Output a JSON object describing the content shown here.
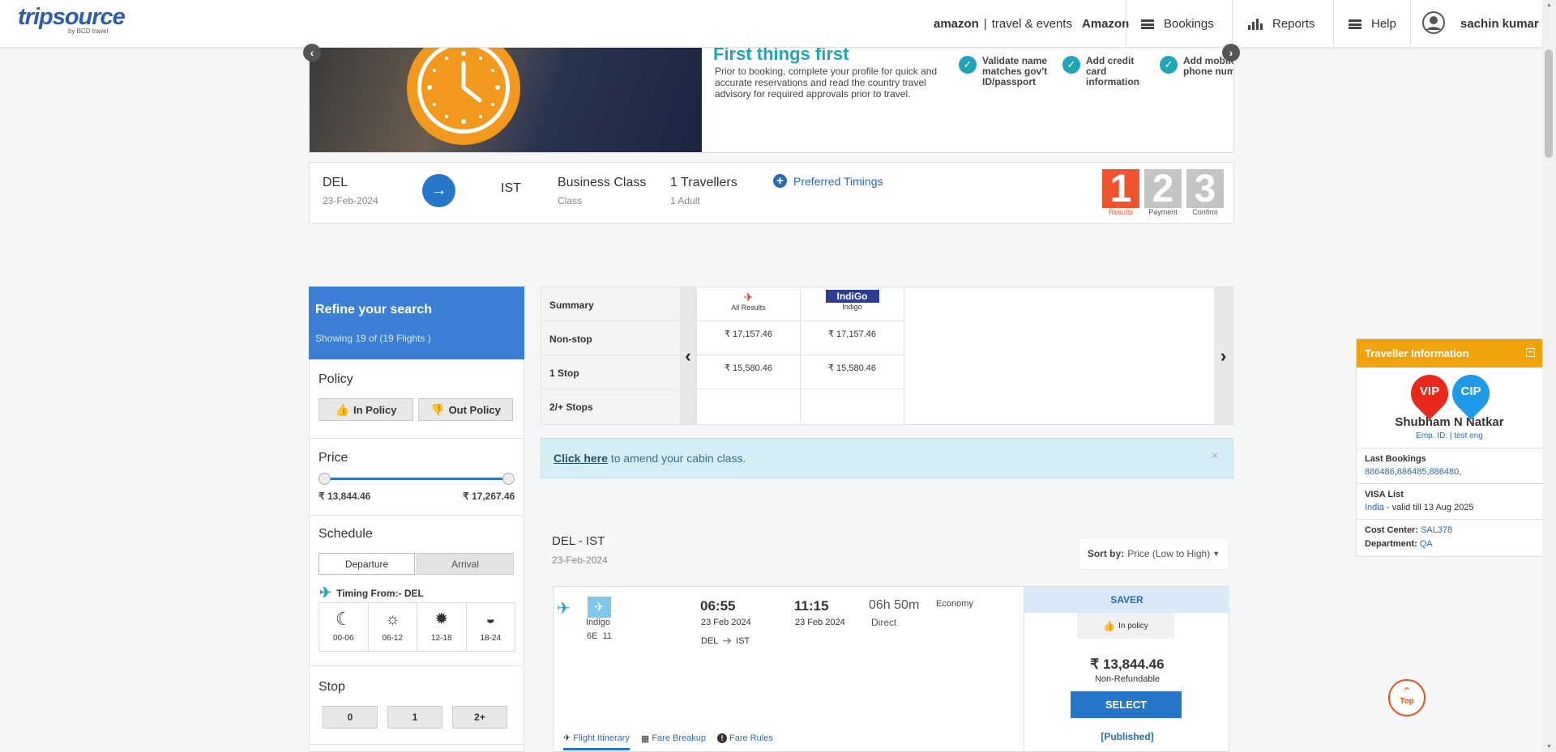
{
  "header": {
    "logo_main": "tripsource",
    "logo_sub": "by BCD travel",
    "amazon_brand": "amazon",
    "amazon_tagline": "travel & events",
    "amazon_label": "Amazon",
    "nav": [
      {
        "label": "Bookings",
        "icon": "menu-icon"
      },
      {
        "label": "Reports",
        "icon": "bar-chart-icon"
      },
      {
        "label": "Help",
        "icon": "menu-icon"
      }
    ],
    "user_name": "sachin kumar"
  },
  "banner": {
    "title": "First things first",
    "text": "Prior to booking, complete your profile for quick and accurate reservations and read the country travel advisory for required approvals prior to travel.",
    "checks": [
      "Validate name matches gov't ID/passport",
      "Add credit card information",
      "Add mobile phone number"
    ]
  },
  "search": {
    "origin": "DEL",
    "date": "23-Feb-2024",
    "destination": "IST",
    "cabin": "Business Class",
    "cabin_label": "Class",
    "travellers": "1 Travellers",
    "travellers_sub": "1 Adult",
    "preferred_timings": "Preferred Timings",
    "steps": [
      {
        "num": "1",
        "label": "Results",
        "color": "#f0532d",
        "active": true
      },
      {
        "num": "2",
        "label": "Payment",
        "color": "#c4c4c4",
        "active": false
      },
      {
        "num": "3",
        "label": "Confirm",
        "color": "#c4c4c4",
        "active": false
      }
    ]
  },
  "sidebar": {
    "title": "Refine your search",
    "showing": "Showing 19 of (19 Flights )",
    "policy_title": "Policy",
    "in_policy": "In Policy",
    "out_policy": "Out Policy",
    "price_title": "Price",
    "price_min": "₹ 13,844.46",
    "price_max": "₹ 17,267.46",
    "schedule_title": "Schedule",
    "departure": "Departure",
    "arrival": "Arrival",
    "timing_from": "Timing From:- DEL",
    "time_slots": [
      {
        "label": "00-06",
        "icon": "moon-icon"
      },
      {
        "label": "06-12",
        "icon": "sunrise-icon"
      },
      {
        "label": "12-18",
        "icon": "sun-icon"
      },
      {
        "label": "18-24",
        "icon": "sunset-icon"
      }
    ],
    "stop_title": "Stop",
    "stops": [
      "0",
      "1",
      "2+"
    ]
  },
  "matrix": {
    "row_labels": [
      "Summary",
      "Non-stop",
      "1 Stop",
      "2/+ Stops"
    ],
    "columns": [
      {
        "name": "All Results",
        "nonstop": "₹ 17,157.46",
        "one_stop": "₹ 15,580.46",
        "two_stop": ""
      },
      {
        "name": "Indigo",
        "logo": "IndiGo",
        "nonstop": "₹ 17,157.46",
        "one_stop": "₹ 15,580.46",
        "two_stop": ""
      }
    ]
  },
  "alert": {
    "link": "Click here",
    "text": " to amend your cabin class."
  },
  "results": {
    "route": "DEL - IST",
    "date": "23-Feb-2024",
    "sort_label": "Sort by:",
    "sort_value": "Price (Low to High)"
  },
  "flight": {
    "airline": "Indigo",
    "flight_no": "6E  11",
    "dep_time": "06:55",
    "dep_date": "23 Feb 2024",
    "arr_time": "11:15",
    "arr_date": "23 Feb 2024",
    "duration": "06h 50m",
    "stops": "Direct",
    "cabin": "Economy",
    "from": "DEL",
    "to": "IST",
    "fare_type": "SAVER",
    "policy": "In policy",
    "price": "₹ 13,844.46",
    "refund": "Non-Refundable",
    "select": "SELECT",
    "published": "[Published]",
    "tabs": [
      "Flight Itinerary",
      "Fare Breakup",
      "Fare Rules"
    ]
  },
  "traveller": {
    "title": "Traveller Information",
    "badges": [
      "VIP",
      "CIP"
    ],
    "name": "Shubham N Natkar",
    "emp": "Emp. ID: | test eng",
    "last_bookings_label": "Last Bookings",
    "last_bookings": "886486,886485,886480,",
    "visa_label": "VISA List",
    "visa_country": "India",
    "visa_valid": " - valid till 13 Aug 2025",
    "cost_center_label": "Cost Center:",
    "cost_center": "SAL378",
    "department_label": "Department:",
    "department": "QA"
  },
  "top_button": "Top",
  "colors": {
    "primary": "#2b6cb0",
    "sidebar_head": "#3a7fd5",
    "step_active": "#f0532d",
    "traveller_head": "#f0a30a",
    "vip": "#e8291c",
    "cip": "#1e9be8"
  }
}
